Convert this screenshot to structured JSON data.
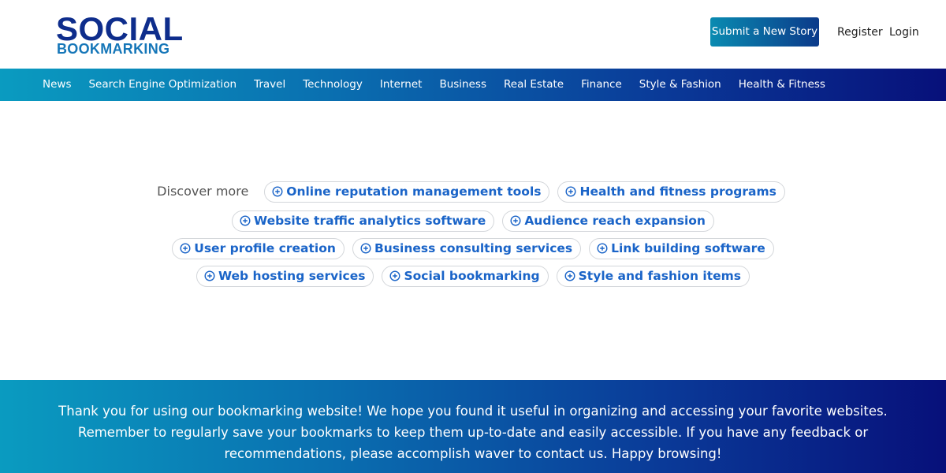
{
  "header": {
    "logo": {
      "line1": "SOCIAL",
      "line2": "BOOKMARKING"
    },
    "submit_label": "Submit a New Story",
    "register_label": "Register",
    "login_label": "Login"
  },
  "nav": {
    "items": [
      "News",
      "Search Engine Optimization",
      "Travel",
      "Technology",
      "Internet",
      "Business",
      "Real Estate",
      "Finance",
      "Style & Fashion",
      "Health & Fitness"
    ]
  },
  "discover": {
    "label": "Discover more",
    "chips": [
      "Online reputation management tools",
      "Health and fitness programs",
      "Website traffic analytics software",
      "Audience reach expansion",
      "User profile creation",
      "Business consulting services",
      "Link building software",
      "Web hosting services",
      "Social bookmarking",
      "Style and fashion items"
    ]
  },
  "footer": {
    "text": "Thank you for using our bookmarking website! We hope you found it useful in organizing and accessing your favorite websites. Remember to regularly save your bookmarks to keep them up-to-date and easily accessible. If you have any feedback or recommendations, please accomplish waver to contact us. Happy browsing!"
  },
  "colors": {
    "brand_navy": "#0e2d8c",
    "brand_blue": "#1576b8",
    "chip_text": "#1a64c8",
    "gradient_start": "#0a9bc0",
    "gradient_end": "#07107a"
  }
}
